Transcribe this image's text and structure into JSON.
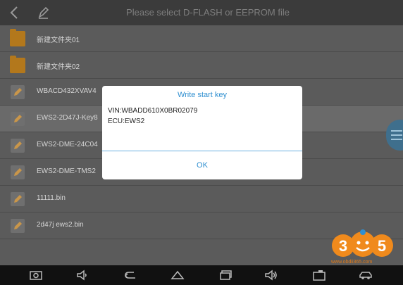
{
  "header": {
    "title": "Please select D-FLASH or EEPROM file",
    "back_icon": "back-arrow-icon",
    "edit_icon": "pencil-icon"
  },
  "files": [
    {
      "name": "新建文件夹01",
      "type": "folder"
    },
    {
      "name": "新建文件夹02",
      "type": "folder"
    },
    {
      "name": "WBACD432XVAV4",
      "type": "file"
    },
    {
      "name": "EWS2-2D47J-Key8",
      "type": "file"
    },
    {
      "name": "EWS2-DME-24C04",
      "type": "file"
    },
    {
      "name": "EWS2-DME-TMS2",
      "type": "file"
    },
    {
      "name": "11111.bin",
      "type": "file"
    },
    {
      "name": "2d47j ews2.bin",
      "type": "file"
    }
  ],
  "dialog": {
    "title": "Write start key",
    "vin": "VIN:WBADD610X0BR02079",
    "ecu": "ECU:EWS2",
    "ok_label": "OK"
  },
  "watermark": {
    "logo_text": "365",
    "url": "www.obdii365.com"
  },
  "navbar": {
    "icons": [
      "screenshot-icon",
      "volume-down-icon",
      "back-icon",
      "home-icon",
      "recent-apps-icon",
      "volume-up-icon",
      "camera-icon",
      "car-icon"
    ]
  },
  "colors": {
    "accent": "#2f8fd0",
    "folder": "#b3781c",
    "logo": "#f08a1c"
  }
}
